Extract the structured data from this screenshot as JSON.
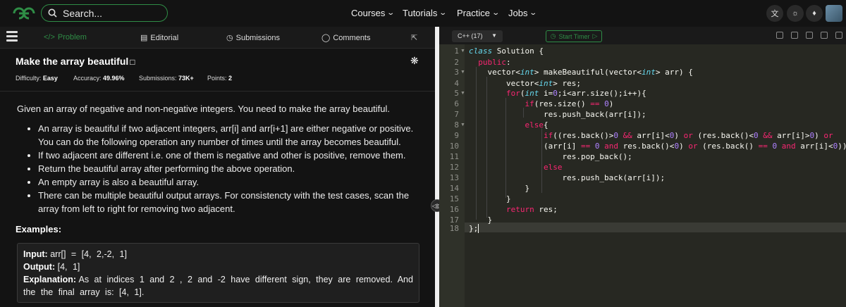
{
  "nav": {
    "search_placeholder": "Search...",
    "links": [
      "Courses",
      "Tutorials",
      "Practice",
      "Jobs"
    ]
  },
  "tabs": [
    "Problem",
    "Editorial",
    "Submissions",
    "Comments"
  ],
  "problem": {
    "title": "Make the array beautiful",
    "difficulty_label": "Difficulty:",
    "difficulty": "Easy",
    "accuracy_label": "Accuracy:",
    "accuracy": "49.96%",
    "submissions_label": "Submissions:",
    "submissions": "73K+",
    "points_label": "Points:",
    "points": "2",
    "intro": "Given an array of negative and non-negative integers. You need to make the array beautiful.",
    "bullets": [
      "An array is beautiful if two adjacent integers, arr[i] and arr[i+1] are either negative or positive. You can do the following operation any number of times until the array becomes beautiful.",
      "If two adjacent are different i.e. one of them is negative and other is positive, remove them.",
      "Return the beautiful array after performing the above operation.",
      "An empty array is also a beautiful array.",
      "There can be multiple beautiful output arrays. For consistencty with the test cases, scan the array from left to right for removing two adjacent."
    ],
    "examples_heading": "Examples:",
    "example": {
      "input_label": "Input:",
      "input": "arr[] = [4, 2,-2, 1]",
      "output_label": "Output:",
      "output": "[4, 1]",
      "explanation_label": "Explanation:",
      "explanation": "As at indices 1 and 2 , 2 and -2 have different sign, they are removed. And the the final array is: [4, 1]."
    }
  },
  "editor": {
    "language": "C++ (17)",
    "timer_label": "Start Timer",
    "line_numbers": [
      "1",
      "2",
      "3",
      "4",
      "5",
      "6",
      "7",
      "8",
      "9",
      "10",
      "11",
      "12",
      "13",
      "14",
      "15",
      "16",
      "17",
      "18"
    ]
  },
  "colors": {
    "brand": "#2f8d46",
    "editor_bg": "#272822",
    "keyword": "#f92672",
    "type": "#66d9ef",
    "number": "#ae81ff"
  }
}
